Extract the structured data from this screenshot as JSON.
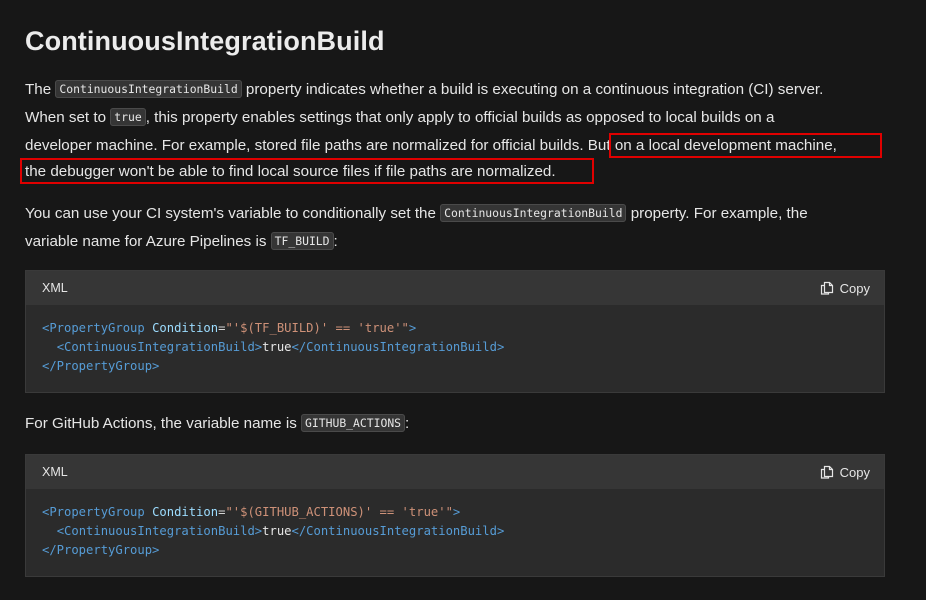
{
  "title": "ContinuousIntegrationBuild",
  "para1": {
    "l1_a": "The ",
    "l1_code": "ContinuousIntegrationBuild",
    "l1_b": " property indicates whether a build is executing on a continuous integration (CI) server.",
    "l2_a": "When set to ",
    "l2_code": "true",
    "l2_b": ", this property enables settings that only apply to official builds as opposed to local builds on a",
    "l3_a": "developer machine. For example, stored file paths are normalized for official builds. ",
    "l3_hl": "But on a local development machine,",
    "l4_hl": "the debugger won't be able to find local source files if file paths are normalized."
  },
  "para2": {
    "l1_a": "You can use your CI system's variable to conditionally set the ",
    "l1_code": "ContinuousIntegrationBuild",
    "l1_b": " property. For example, the",
    "l2_a": "variable name for Azure Pipelines is ",
    "l2_code": "TF_BUILD",
    "l2_b": ":"
  },
  "codeblock1": {
    "lang": "XML",
    "copy_label": "Copy",
    "line1": {
      "open": "<PropertyGroup ",
      "attr": "Condition",
      "eq": "=",
      "value": "\"'$(TF_BUILD)' == 'true'\"",
      "close": ">"
    },
    "line2": {
      "open": "<ContinuousIntegrationBuild>",
      "text": "true",
      "close": "</ContinuousIntegrationBuild>"
    },
    "line3": "</PropertyGroup>"
  },
  "para3": {
    "a": "For GitHub Actions, the variable name is ",
    "code": "GITHUB_ACTIONS",
    "b": ":"
  },
  "codeblock2": {
    "lang": "XML",
    "copy_label": "Copy",
    "line1": {
      "open": "<PropertyGroup ",
      "attr": "Condition",
      "eq": "=",
      "value": "\"'$(GITHUB_ACTIONS)' == 'true'\"",
      "close": ">"
    },
    "line2": {
      "open": "<ContinuousIntegrationBuild>",
      "text": "true",
      "close": "</ContinuousIntegrationBuild>"
    },
    "line3": "</PropertyGroup>"
  },
  "colors": {
    "background": "#171717",
    "highlight_border": "#e00000",
    "tag": "#569cd6",
    "attribute": "#9cdcfe",
    "string": "#ce9178"
  },
  "icons": {
    "copy": "copy-icon"
  }
}
